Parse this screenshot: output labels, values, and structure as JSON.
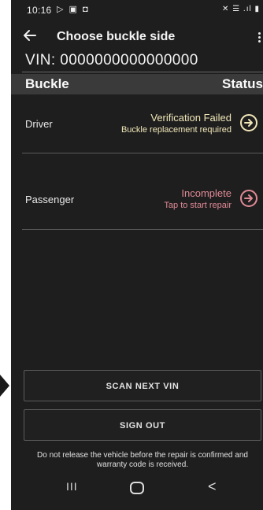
{
  "status_bar": {
    "time": "10:16",
    "left_icons": "▷ ▣ ◘",
    "right_icons": "✕ ☰ .ıl ▮"
  },
  "toolbar": {
    "back_icon": "arrow-left",
    "title": "Choose buckle side",
    "more_icon": "vertical-dots"
  },
  "vin": {
    "text": "VIN: 0000000000000000"
  },
  "table": {
    "col_buckle": "Buckle",
    "col_status": "Status",
    "rows": [
      {
        "name": "Driver",
        "status": "Verification Failed",
        "detail": "Buckle replacement required",
        "color": "#f0e6b8",
        "arrow_color": "#f0e6b8"
      },
      {
        "name": "Passenger",
        "status": "Incomplete",
        "detail": "Tap to start repair",
        "color": "#e08a96",
        "arrow_color": "#e08a96"
      }
    ]
  },
  "buttons": {
    "scan_next": "SCAN NEXT VIN",
    "sign_out": "SIGN OUT"
  },
  "footnote": "Do not release the vehicle before the repair is confirmed and warranty code is received.",
  "nav_bar": {
    "recents": "III",
    "back": "<"
  },
  "colors": {
    "background": "#1e1e1e",
    "header_band": "#3a3a3a",
    "verification_failed": "#f0e6b8",
    "incomplete": "#e08a96"
  }
}
